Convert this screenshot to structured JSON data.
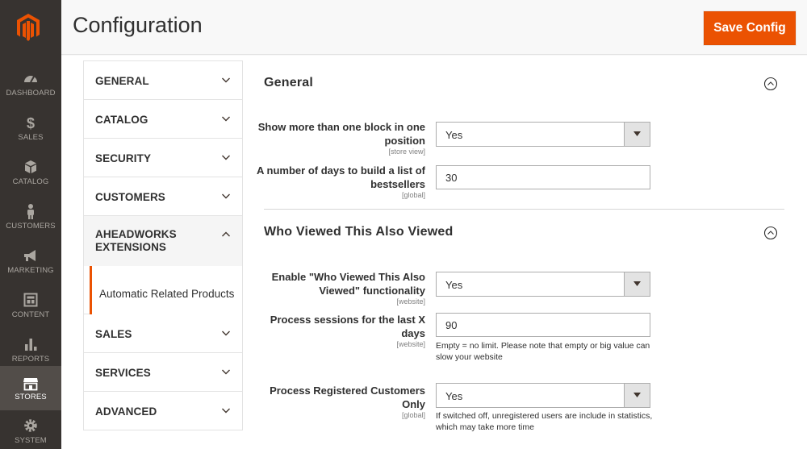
{
  "page": {
    "title": "Configuration",
    "save_label": "Save Config",
    "accent": "#eb5202"
  },
  "admin_menu": [
    {
      "label": "DASHBOARD",
      "icon": "dashboard-icon"
    },
    {
      "label": "SALES",
      "icon": "dollar-icon"
    },
    {
      "label": "CATALOG",
      "icon": "box-icon"
    },
    {
      "label": "CUSTOMERS",
      "icon": "person-icon"
    },
    {
      "label": "MARKETING",
      "icon": "megaphone-icon"
    },
    {
      "label": "CONTENT",
      "icon": "layout-icon"
    },
    {
      "label": "REPORTS",
      "icon": "bar-chart-icon"
    },
    {
      "label": "STORES",
      "icon": "storefront-icon"
    },
    {
      "label": "SYSTEM",
      "icon": "gear-icon"
    }
  ],
  "tabs": {
    "general": "GENERAL",
    "catalog": "CATALOG",
    "security": "SECURITY",
    "customers": "CUSTOMERS",
    "aheadworks": "AHEADWORKS EXTENSIONS",
    "automatic_related": "Automatic Related Products",
    "sales": "SALES",
    "services": "SERVICES",
    "advanced": "ADVANCED"
  },
  "general_section": {
    "title": "General",
    "multi_block": {
      "label": "Show more than one block in one position",
      "scope": "[store view]",
      "value": "Yes"
    },
    "bestseller_days": {
      "label": "A number of days to build a list of bestsellers",
      "scope": "[global]",
      "value": "30"
    }
  },
  "wvav_section": {
    "title": "Who Viewed This Also Viewed",
    "enable": {
      "label": "Enable \"Who Viewed This Also Viewed\" functionality",
      "scope": "[website]",
      "value": "Yes"
    },
    "sessions": {
      "label": "Process sessions for the last X days",
      "scope": "[website]",
      "value": "90",
      "note": "Empty = no limit. Please note that empty or big value can slow your website"
    },
    "registered_only": {
      "label": "Process Registered Customers Only",
      "scope": "[global]",
      "value": "Yes",
      "note": "If switched off, unregistered users are include in statistics, which may take more time"
    }
  }
}
